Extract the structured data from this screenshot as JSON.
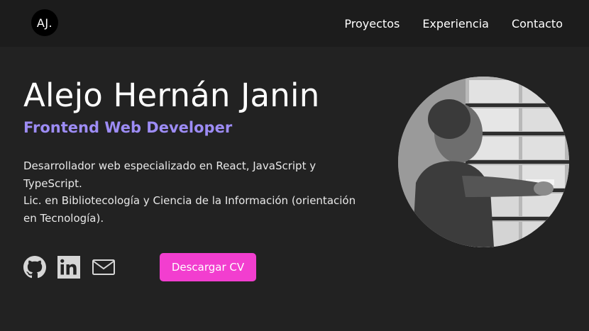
{
  "logo": {
    "text": "AJ."
  },
  "nav": {
    "links": [
      {
        "label": "Proyectos"
      },
      {
        "label": "Experiencia"
      },
      {
        "label": "Contacto"
      }
    ]
  },
  "hero": {
    "name": "Alejo Hernán Janin",
    "role": "Frontend Web Developer",
    "description_line1": "Desarrollador web especializado en React, JavaScript y TypeScript.",
    "description_line2": "Lic. en Bibliotecología y Ciencia de la Información (orientación en Tecnología).",
    "cv_button": "Descargar CV"
  },
  "socials": [
    {
      "icon": "github-icon"
    },
    {
      "icon": "linkedin-icon"
    },
    {
      "icon": "mail-icon"
    }
  ],
  "colors": {
    "background": "#222222",
    "navbar": "#1c1c1c",
    "accent_role": "#9d8cf5",
    "accent_button": "#f23ecf"
  }
}
